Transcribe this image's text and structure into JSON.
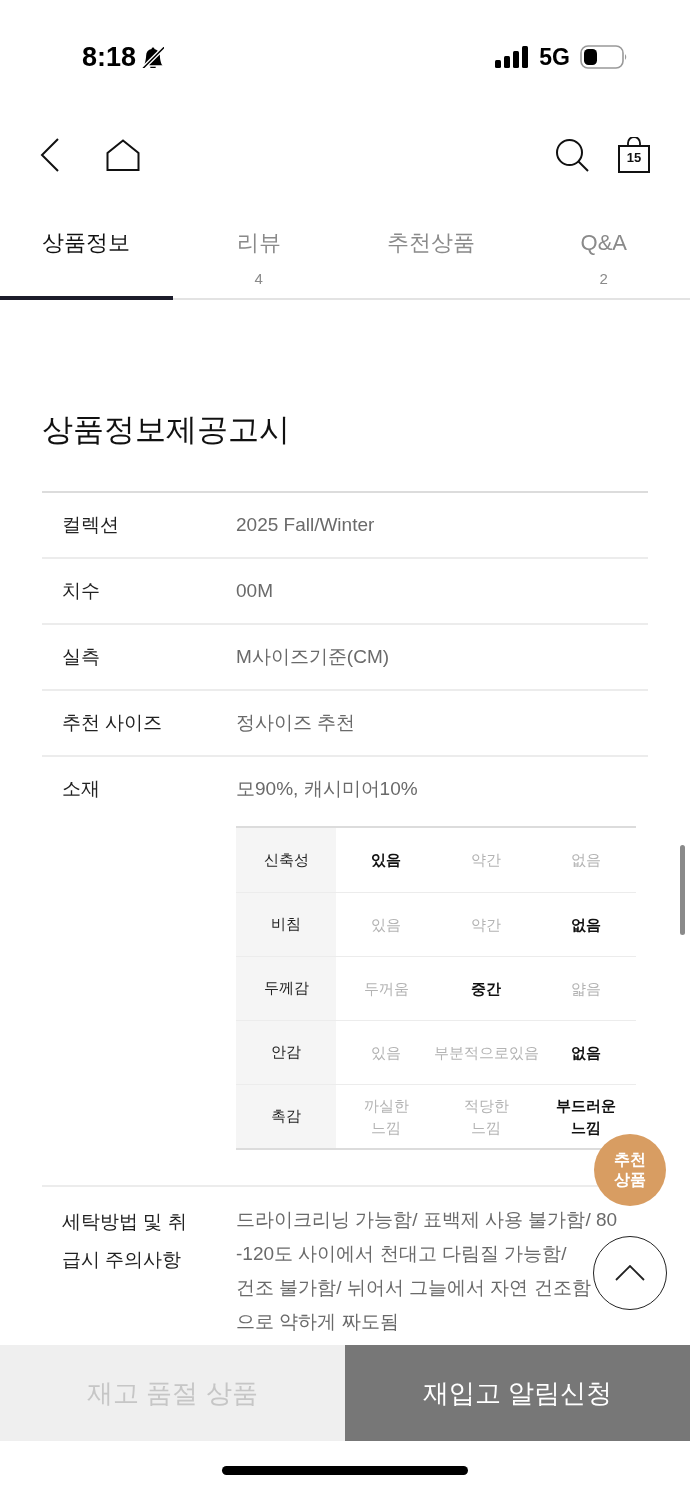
{
  "status_bar": {
    "time": "8:18",
    "network": "5G"
  },
  "nav": {
    "cart_count": "15"
  },
  "tabs": [
    {
      "label": "상품정보",
      "selected": true
    },
    {
      "label": "리뷰",
      "count": "4",
      "selected": false
    },
    {
      "label": "추천상품",
      "selected": false
    },
    {
      "label": "Q&A",
      "count": "2",
      "selected": false
    }
  ],
  "notice": {
    "title": "상품정보제공고시",
    "rows": [
      {
        "kind": "text",
        "label": "컬렉션",
        "value": "2025 Fall/Winter"
      },
      {
        "kind": "text",
        "label": "치수",
        "value": "00M"
      },
      {
        "kind": "text",
        "label": "실측",
        "value": "M사이즈기준(CM)"
      },
      {
        "kind": "text",
        "label": "추천 사이즈",
        "value": "정사이즈 추천"
      },
      {
        "kind": "material",
        "label": "소재",
        "value": "모90%, 캐시미어10%",
        "attributes": [
          {
            "label": "신축성",
            "options": [
              {
                "text": "있음",
                "selected": true
              },
              {
                "text": "약간",
                "selected": false
              },
              {
                "text": "없음",
                "selected": false
              }
            ]
          },
          {
            "label": "비침",
            "options": [
              {
                "text": "있음",
                "selected": false
              },
              {
                "text": "약간",
                "selected": false
              },
              {
                "text": "없음",
                "selected": true
              }
            ]
          },
          {
            "label": "두께감",
            "options": [
              {
                "text": "두꺼움",
                "selected": false
              },
              {
                "text": "중간",
                "selected": true
              },
              {
                "text": "얇음",
                "selected": false
              }
            ]
          },
          {
            "label": "안감",
            "options": [
              {
                "text": "있음",
                "selected": false
              },
              {
                "text": "부분적으로있음",
                "selected": false
              },
              {
                "text": "없음",
                "selected": true
              }
            ]
          },
          {
            "label": "촉감",
            "options": [
              {
                "text": "까실한 느낌",
                "selected": false
              },
              {
                "text": "적당한 느낌",
                "selected": false
              },
              {
                "text": "부드러운 느낌",
                "selected": true
              }
            ]
          }
        ]
      },
      {
        "kind": "care",
        "label": "세탁방법 및 취급시 주의사항",
        "value_lines": [
          "드라이크리닝 가능함/ 표백제 사용 불가함/ 80",
          "-120도 사이에서 천대고 다림질 가능함/",
          "건조 불가함/ 뉘어서 그늘에서 자연 건조함",
          "으로 약하게 짜도됨"
        ]
      }
    ]
  },
  "floating": {
    "recommend": "추천 상품"
  },
  "bottom_bar": {
    "status": {
      "label": "재고 품절 상품",
      "disabled": true
    },
    "button": {
      "label": "재입고 알림신청",
      "disabled": false
    }
  }
}
